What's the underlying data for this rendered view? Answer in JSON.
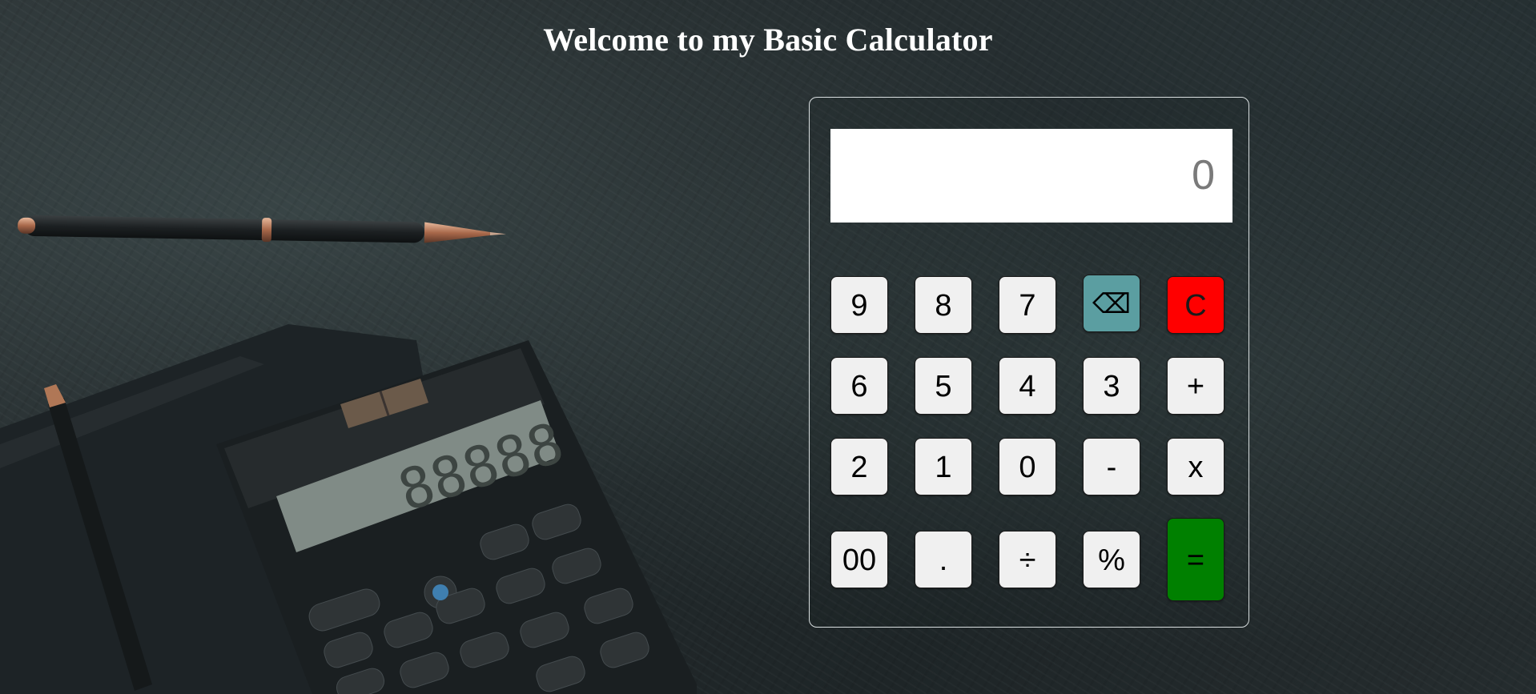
{
  "page": {
    "title": "Welcome to my Basic Calculator"
  },
  "calculator": {
    "display_value": "0",
    "keys": {
      "k9": "9",
      "k8": "8",
      "k7": "7",
      "backspace": "⌫",
      "clear": "C",
      "k6": "6",
      "k5": "5",
      "k4": "4",
      "k3": "3",
      "plus": "+",
      "k2": "2",
      "k1": "1",
      "k0": "0",
      "minus": "-",
      "multiply": "x",
      "k00": "00",
      "decimal": ".",
      "divide": "÷",
      "percent": "%",
      "equals": "="
    }
  },
  "colors": {
    "backspace_bg": "#5b9ea1",
    "clear_bg": "#ff0000",
    "equals_bg": "#008000",
    "key_bg": "#f0f0f0",
    "display_bg": "#ffffff",
    "title_color": "#ffffff"
  },
  "background": {
    "description_icon": "desk-with-pen-and-calculator"
  }
}
